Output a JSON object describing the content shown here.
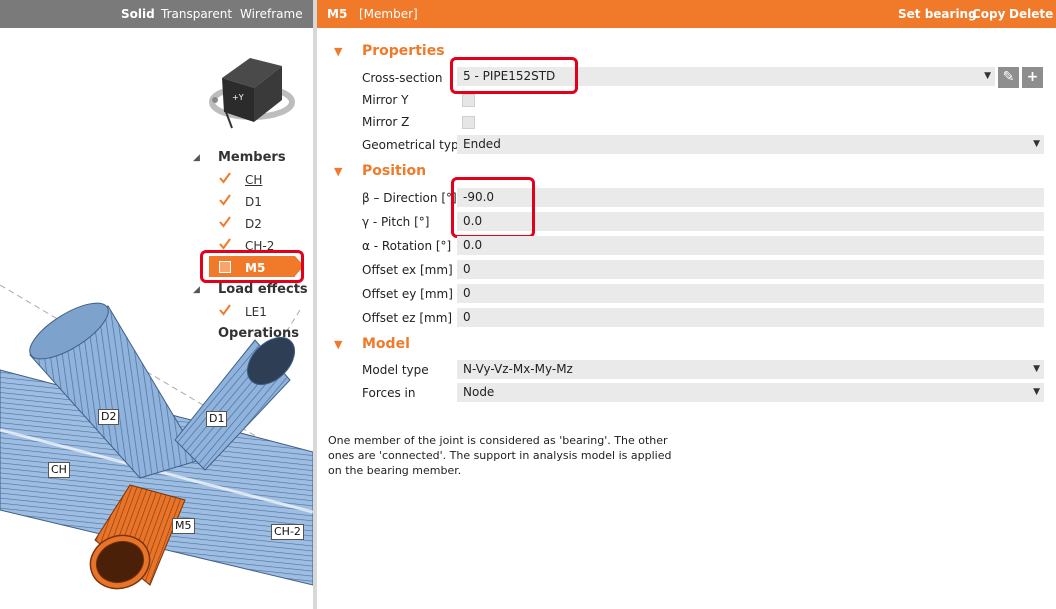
{
  "view_modes": [
    "Solid",
    "Transparent",
    "Wireframe"
  ],
  "header": {
    "title": "M5",
    "subtitle": "[Member]",
    "actions": [
      "Set bearing",
      "Copy",
      "Delete"
    ]
  },
  "navcube": {
    "face_label": "+Y"
  },
  "tree": {
    "members_label": "Members",
    "members": [
      "CH",
      "D1",
      "D2",
      "CH-2",
      "M5"
    ],
    "selected": "M5",
    "load_effects_label": "Load effects",
    "load_effects": [
      "LE1"
    ],
    "operations_label": "Operations"
  },
  "scene_labels": {
    "d2": "D2",
    "d1": "D1",
    "ch": "CH",
    "m5": "M5",
    "ch2": "CH-2"
  },
  "properties": {
    "title": "Properties",
    "cross_section_label": "Cross-section",
    "cross_section_value": "5 - PIPE152STD",
    "mirror_y_label": "Mirror Y",
    "mirror_z_label": "Mirror Z",
    "geom_type_label": "Geometrical type",
    "geom_type_value": "Ended"
  },
  "position": {
    "title": "Position",
    "direction_label": "β – Direction [°]",
    "direction_value": "-90.0",
    "pitch_label": "γ - Pitch [°]",
    "pitch_value": "0.0",
    "rotation_label": "α - Rotation [°]",
    "rotation_value": "0.0",
    "offset_ex_label": "Offset ex [mm]",
    "offset_ex_value": "0",
    "offset_ey_label": "Offset ey [mm]",
    "offset_ey_value": "0",
    "offset_ez_label": "Offset ez [mm]",
    "offset_ez_value": "0"
  },
  "model": {
    "title": "Model",
    "model_type_label": "Model type",
    "model_type_value": "N-Vy-Vz-Mx-My-Mz",
    "forces_in_label": "Forces in",
    "forces_in_value": "Node"
  },
  "note": "One member of the joint is considered as 'bearing'. The other ones are 'connected'. The support in analysis model is applied on the bearing member.",
  "colors": {
    "accent": "#f07a2a",
    "highlight": "#e2001a",
    "pipe": "#8fb3dc",
    "pipe_selected": "#e8742a"
  },
  "icons": {
    "edit": "pencil-icon",
    "add": "plus-icon",
    "dropdown": "chevron-down-icon",
    "expand": "triangle-down-icon",
    "check": "checkmark-icon"
  }
}
